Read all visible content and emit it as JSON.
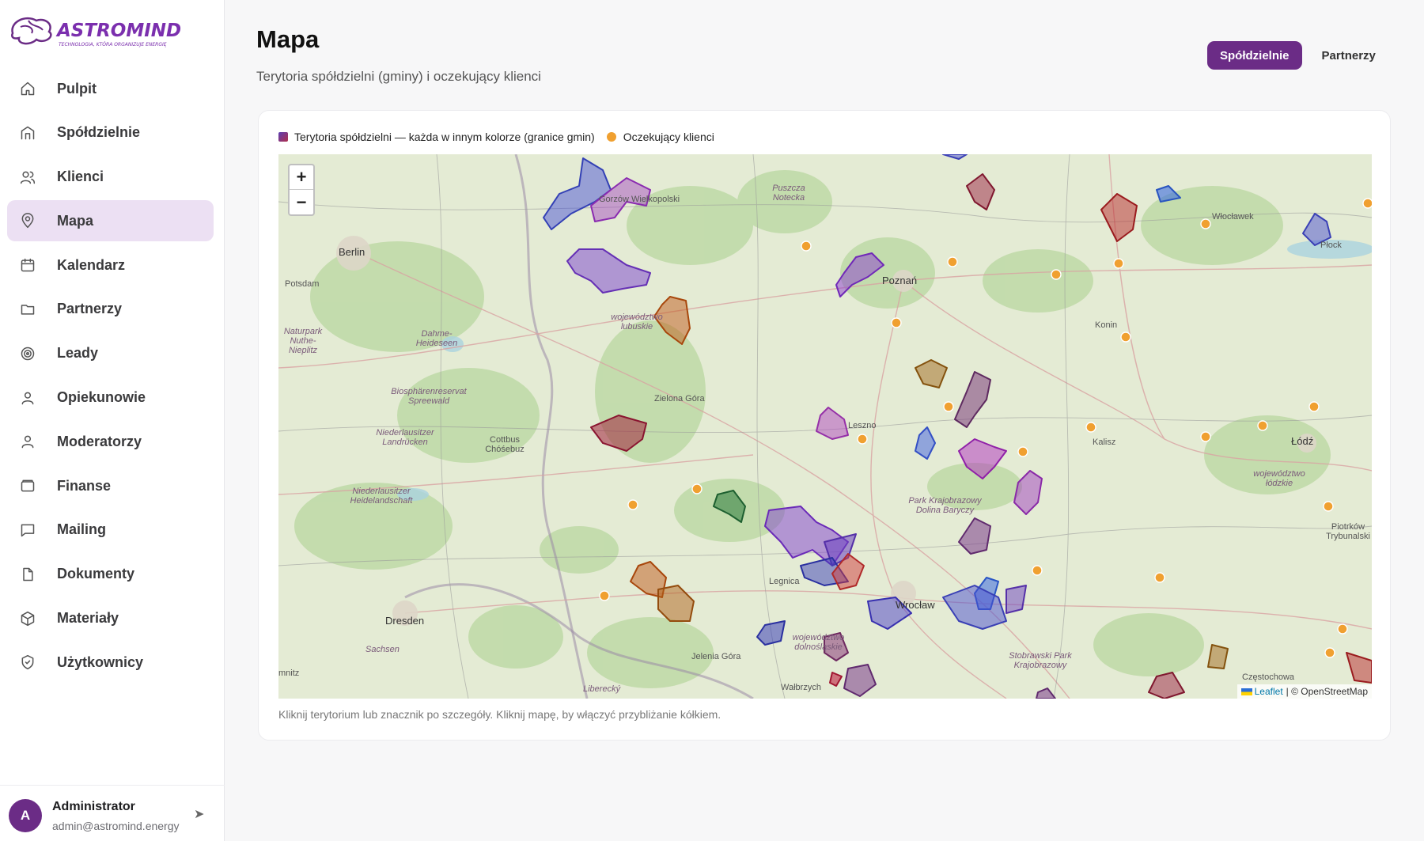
{
  "app": {
    "logo_text": "ASTROMIND",
    "logo_tagline": "TECHNOLOGIA, KTÓRA ORGANIZUJE ENERGIĘ"
  },
  "sidebar": {
    "items": [
      {
        "label": "Pulpit",
        "icon": "home-icon"
      },
      {
        "label": "Spółdzielnie",
        "icon": "building-icon"
      },
      {
        "label": "Klienci",
        "icon": "users-icon"
      },
      {
        "label": "Mapa",
        "icon": "map-pin-icon",
        "active": true
      },
      {
        "label": "Kalendarz",
        "icon": "calendar-icon"
      },
      {
        "label": "Partnerzy",
        "icon": "folder-icon"
      },
      {
        "label": "Leady",
        "icon": "target-icon"
      },
      {
        "label": "Opiekunowie",
        "icon": "user-icon"
      },
      {
        "label": "Moderatorzy",
        "icon": "user-icon"
      },
      {
        "label": "Finanse",
        "icon": "wallet-icon"
      },
      {
        "label": "Mailing",
        "icon": "message-icon"
      },
      {
        "label": "Dokumenty",
        "icon": "file-icon"
      },
      {
        "label": "Materiały",
        "icon": "box-icon"
      },
      {
        "label": "Użytkownicy",
        "icon": "shield-icon"
      }
    ],
    "user": {
      "initial": "A",
      "name": "Administrator",
      "email": "admin@astromind.energy"
    }
  },
  "header": {
    "title": "Mapa",
    "subtitle": "Terytoria spółdzielni (gminy) i oczekujący klienci",
    "toggle": {
      "active": "Spółdzielnie",
      "inactive": "Partnerzy"
    }
  },
  "map": {
    "legend_territories": "Terytoria spółdzielni — każda w innym kolorze (granice gmin)",
    "legend_clients": "Oczekujący klienci",
    "zoom_in": "+",
    "zoom_out": "−",
    "attribution_leaflet": "Leaflet",
    "attribution_osm": "| © OpenStreetMap",
    "hint": "Kliknij terytorium lub znacznik po szczegóły. Kliknij mapę, by włączyć przybliżanie kółkiem.",
    "cities": [
      "Berlin",
      "Potsdam",
      "Poznań",
      "Zielona Góra",
      "Cottbus Chóśebuz",
      "Dresden",
      "Legnica",
      "Wrocław",
      "Jelenia Góra",
      "Wałbrzych",
      "Leszno",
      "Kalisz",
      "Łódź",
      "Konin",
      "Płock",
      "Włocławek",
      "Częstochowa",
      "Piotrków Trybunalski",
      "Gorzów Wielkopolski"
    ],
    "regions": [
      "województwo lubuskie",
      "województwo dolnośląskie",
      "województwo łódzkie",
      "Park Krajobrazowy Dolina Baryczy",
      "Puszcza Notecka",
      "Dahme-Heideseen",
      "Biosphärenreservat Spreewald",
      "Niederlausitzer Landrücken",
      "Niederlausitzer Heidelandschaft",
      "Naturpark Nuthe-Nieplitz",
      "Stobrawski Park Krajobrazowy",
      "Sachsen",
      "Liberecký",
      "mnitz"
    ],
    "colors": {
      "accent": "#6b2c86",
      "client_marker": "#f0a030"
    }
  }
}
